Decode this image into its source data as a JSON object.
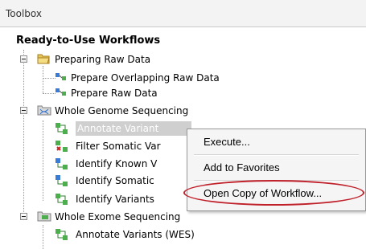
{
  "panel": {
    "title": "Toolbox"
  },
  "tree": {
    "root": "Ready-to-Use Workflows",
    "folders": [
      {
        "label": "Preparing Raw Data",
        "items": [
          "Prepare Overlapping Raw Data",
          "Prepare Raw Data"
        ]
      },
      {
        "label": "Whole Genome Sequencing",
        "items": [
          "Annotate Variants (WGS)",
          "Filter Somatic Var",
          "Identify Known V",
          "Identify Somatic",
          "Identify Variants"
        ]
      },
      {
        "label": "Whole Exome Sequencing",
        "items": [
          "Annotate Variants (WES)"
        ]
      }
    ],
    "selected_item_visible": "Annotate Variant"
  },
  "context_menu": {
    "items": [
      "Execute...",
      "Add to Favorites",
      "Open Copy of Workflow..."
    ],
    "highlighted": "Open Copy of Workflow..."
  },
  "colors": {
    "highlight_ellipse": "#c0202a",
    "menu_background": "#f5f5f5"
  }
}
